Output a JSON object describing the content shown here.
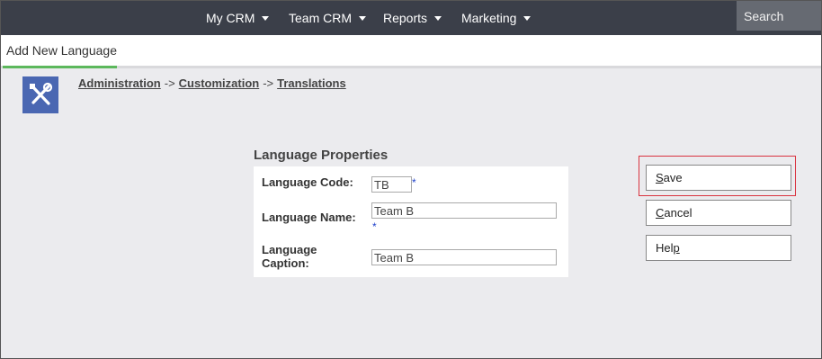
{
  "nav": {
    "items": [
      {
        "label": "My CRM"
      },
      {
        "label": "Team CRM"
      },
      {
        "label": "Reports"
      },
      {
        "label": "Marketing"
      }
    ],
    "search_placeholder": "Search"
  },
  "tab": {
    "label": "Add New Language"
  },
  "breadcrumb": {
    "items": [
      "Administration",
      "Customization",
      "Translations"
    ],
    "separator": "->"
  },
  "form": {
    "section_title": "Language Properties",
    "code_label": "Language Code:",
    "code_value": "TB",
    "name_label": "Language Name:",
    "name_value": "Team B",
    "caption_label_line1": "Language",
    "caption_label_line2": "Caption:",
    "caption_value": "Team B",
    "required_marker": "*"
  },
  "buttons": {
    "save": {
      "mnemonic": "S",
      "rest": "ave"
    },
    "cancel": {
      "mnemonic": "C",
      "rest": "ancel"
    },
    "help": {
      "pre": "Hel",
      "mnemonic": "p"
    }
  },
  "colors": {
    "topbar": "#3b3f49",
    "active_tab_underline": "#5cb85c",
    "icon_bg": "#4a67b2",
    "highlight_border": "#d9333f",
    "required": "#2244cc"
  }
}
